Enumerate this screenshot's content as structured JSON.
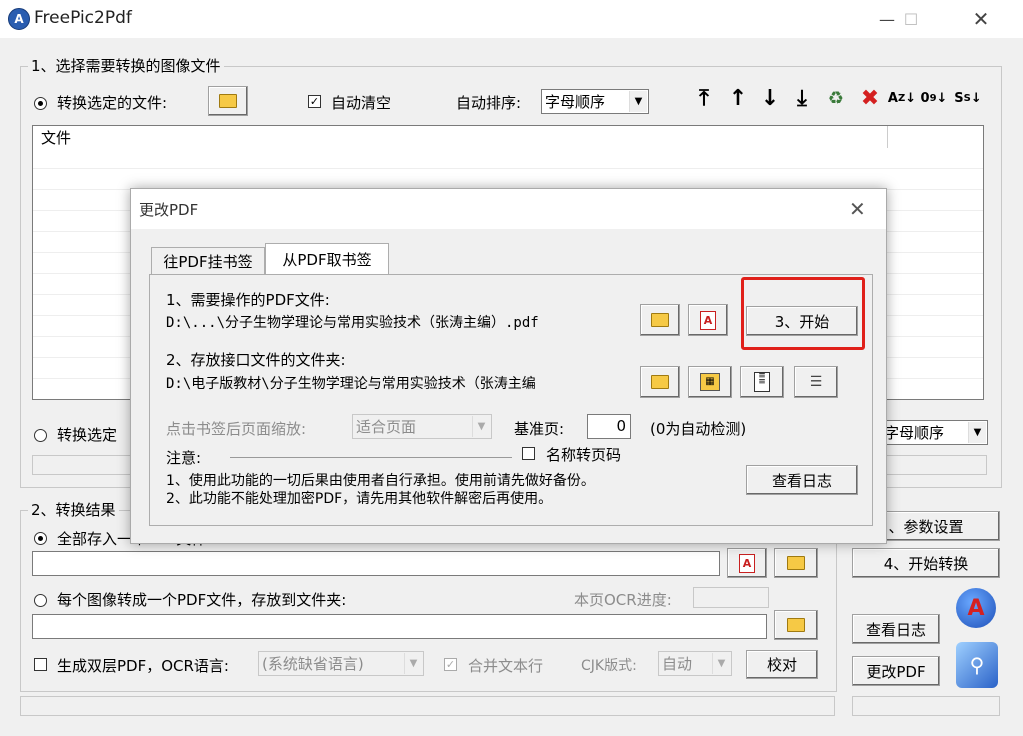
{
  "app": {
    "title": "FreePic2Pdf"
  },
  "section1": {
    "legend": "1、选择需要转换的图像文件",
    "radio_selected_files": "转换选定的文件:",
    "auto_clear": "自动清空",
    "auto_sort_label": "自动排序:",
    "auto_sort_value": "字母顺序",
    "file_list_header": "文件",
    "radio_selected_folder": "转换选定",
    "folder_sort_value": "字母顺序"
  },
  "toolbar_icons": [
    "move-top-icon",
    "move-up-icon",
    "move-down-icon",
    "move-bottom-icon",
    "recycle-icon",
    "delete-icon",
    "sort-az-icon",
    "sort-09-icon",
    "sort-custom-icon"
  ],
  "section2": {
    "legend": "2、转换结果",
    "radio_all_in_one": "全部存入一个PDF文件:",
    "radio_each_image": "每个图像转成一个PDF文件，存放到文件夹:",
    "ocr_progress_label": "本页OCR进度:",
    "dual_layer_label": "生成双层PDF，OCR语言:",
    "ocr_lang_value": "(系统缺省语言)",
    "merge_lines_label": "合并文本行",
    "cjk_label": "CJK版式:",
    "cjk_value": "自动",
    "proofread_btn": "校对"
  },
  "right_buttons": {
    "params": "、参数设置",
    "start_convert": "4、开始转换",
    "view_log": "查看日志",
    "modify_pdf": "更改PDF"
  },
  "dialog": {
    "title": "更改PDF",
    "tabs": [
      "往PDF挂书签",
      "从PDF取书签"
    ],
    "label_pdf_file": "1、需要操作的PDF文件:",
    "pdf_file_path": "D:\\...\\分子生物学理论与常用实验技术（张涛主编）.pdf",
    "start_btn": "3、开始",
    "label_folder": "2、存放接口文件的文件夹:",
    "folder_path": "D:\\电子版教材\\分子生物学理论与常用实验技术（张涛主编",
    "zoom_label": "点击书签后页面缩放:",
    "zoom_value": "适合页面",
    "base_page_label": "基准页:",
    "base_page_value": "0",
    "auto_detect_hint": "(0为自动检测)",
    "name_to_pagecode": "名称转页码",
    "note_label": "注意:",
    "note_1": "1、使用此功能的一切后果由使用者自行承担。使用前请先做好备份。",
    "note_2": "2、此功能不能处理加密PDF，请先用其他软件解密后再使用。",
    "view_log_btn": "查看日志"
  },
  "colors": {
    "highlight": "#e0201a"
  }
}
